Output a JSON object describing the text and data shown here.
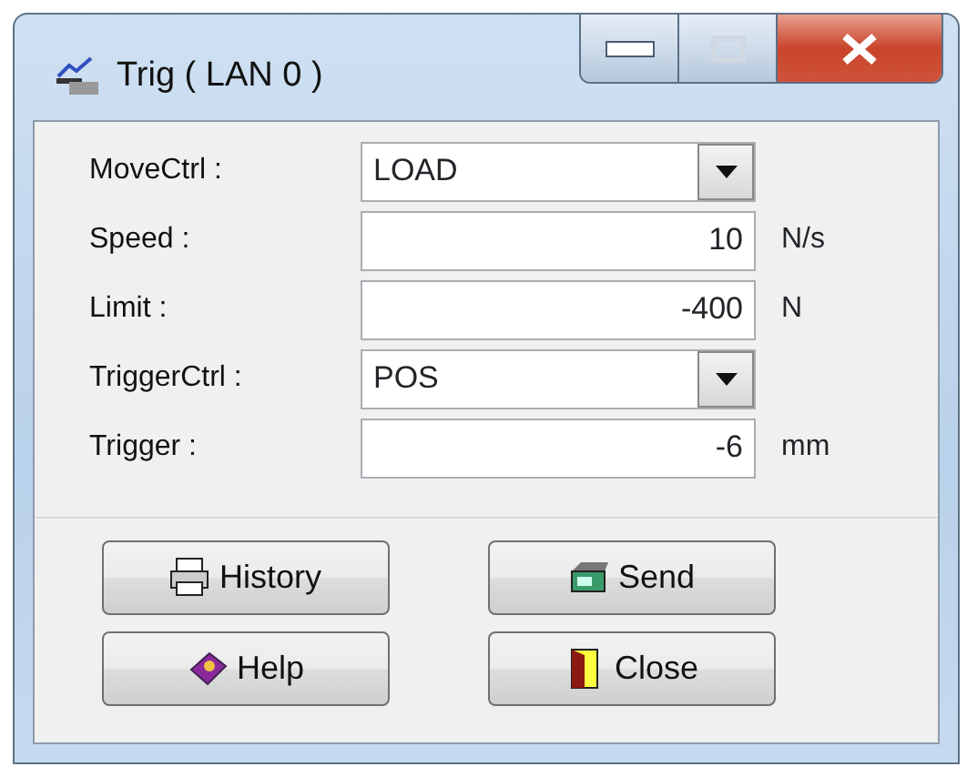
{
  "window": {
    "title": "Trig ( LAN 0 )"
  },
  "fields": [
    {
      "label": "MoveCtrl :",
      "kind": "dropdown",
      "value": "LOAD"
    },
    {
      "label": "Speed :",
      "kind": "number",
      "value": "10",
      "unit": "N/s"
    },
    {
      "label": "Limit :",
      "kind": "number",
      "value": "-400",
      "unit": "N"
    },
    {
      "label": "TriggerCtrl :",
      "kind": "dropdown",
      "value": "POS"
    },
    {
      "label": "Trigger :",
      "kind": "number",
      "value": "-6",
      "unit": "mm"
    }
  ],
  "buttons": [
    {
      "label": "History"
    },
    {
      "label": "Send"
    },
    {
      "label": "Help"
    },
    {
      "label": "Close"
    }
  ]
}
